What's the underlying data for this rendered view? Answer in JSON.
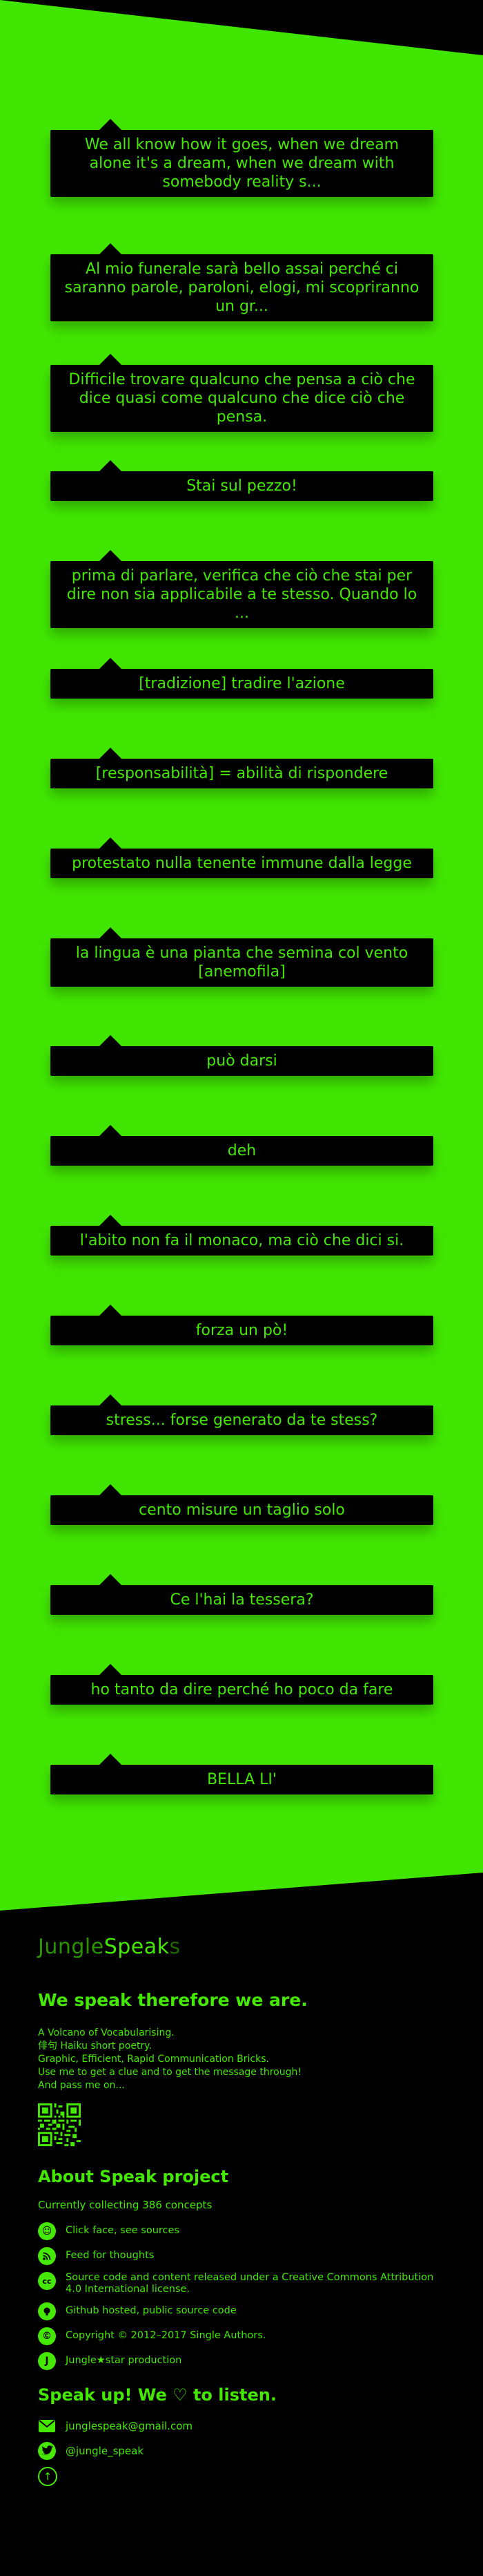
{
  "quotes": [
    {
      "text": "We all know how it goes, when we dream alone it's a dream, when we dream with somebody reality s..."
    },
    {
      "text": "Al mio funerale sarà bello assai perché ci saranno parole, paroloni, elogi, mi scopriranno un gr..."
    },
    {
      "text": "Difficile trovare qualcuno che pensa a ciò che dice quasi come qualcuno che dice ciò che pensa."
    },
    {
      "text": "Stai sul pezzo!"
    },
    {
      "text": "prima di parlare, verifica che ciò che stai per dire non sia applicabile a te stesso. Quando lo ..."
    },
    {
      "text": "[tradizione] tradire l'azione"
    },
    {
      "text": "[responsabilità] = abilità di rispondere"
    },
    {
      "text": "protestato nulla tenente immune dalla legge"
    },
    {
      "text": "la lingua è una pianta che semina col vento [anemofila]"
    },
    {
      "text": "può darsi"
    },
    {
      "text": "deh"
    },
    {
      "text": "l'abito non fa il monaco, ma ciò che dici si."
    },
    {
      "text": "forza un pò!"
    },
    {
      "text": "stress... forse generato da te stess?"
    },
    {
      "text": "cento misure un taglio solo"
    },
    {
      "text": "Ce l'hai la tessera?"
    },
    {
      "text": "ho tanto da dire perché ho poco da fare"
    },
    {
      "text": "BELLA LI'"
    }
  ],
  "footer": {
    "brand": {
      "part1": "Jungle",
      "part2": "Speak",
      "part3": "s"
    },
    "tagline": "We speak therefore we are.",
    "intro": [
      "A Volcano of Vocabularising.",
      "俳句 Haiku short poetry.",
      "Graphic, Efficient, Rapid Communication Bricks.",
      "Use me to get a clue and to get the message through!",
      "And pass me on..."
    ],
    "about_title": "About Speak project",
    "collecting": "Currently collecting 386 concepts",
    "links": [
      {
        "icon": "smiley-icon",
        "label": "Click face, see sources"
      },
      {
        "icon": "rss-icon",
        "label": "Feed for thoughts"
      },
      {
        "icon": "cc-icon",
        "label": "Source code and content released under a Creative Commons Attribution 4.0 International license."
      },
      {
        "icon": "github-icon",
        "label": "Github hosted, public source code"
      },
      {
        "icon": "copyright-icon",
        "label": "Copyright © 2012–2017 Single Authors."
      },
      {
        "icon": "jungle-icon",
        "label": "Jungle★star production"
      }
    ],
    "speakup": "Speak up! We ♡ to listen.",
    "contacts": [
      {
        "icon": "mail-icon",
        "label": "junglespeak@gmail.com"
      },
      {
        "icon": "twitter-icon",
        "label": "@jungle_speak"
      }
    ]
  },
  "colors": {
    "accent": "#44e800",
    "field": "#41e600",
    "background": "#000000"
  }
}
